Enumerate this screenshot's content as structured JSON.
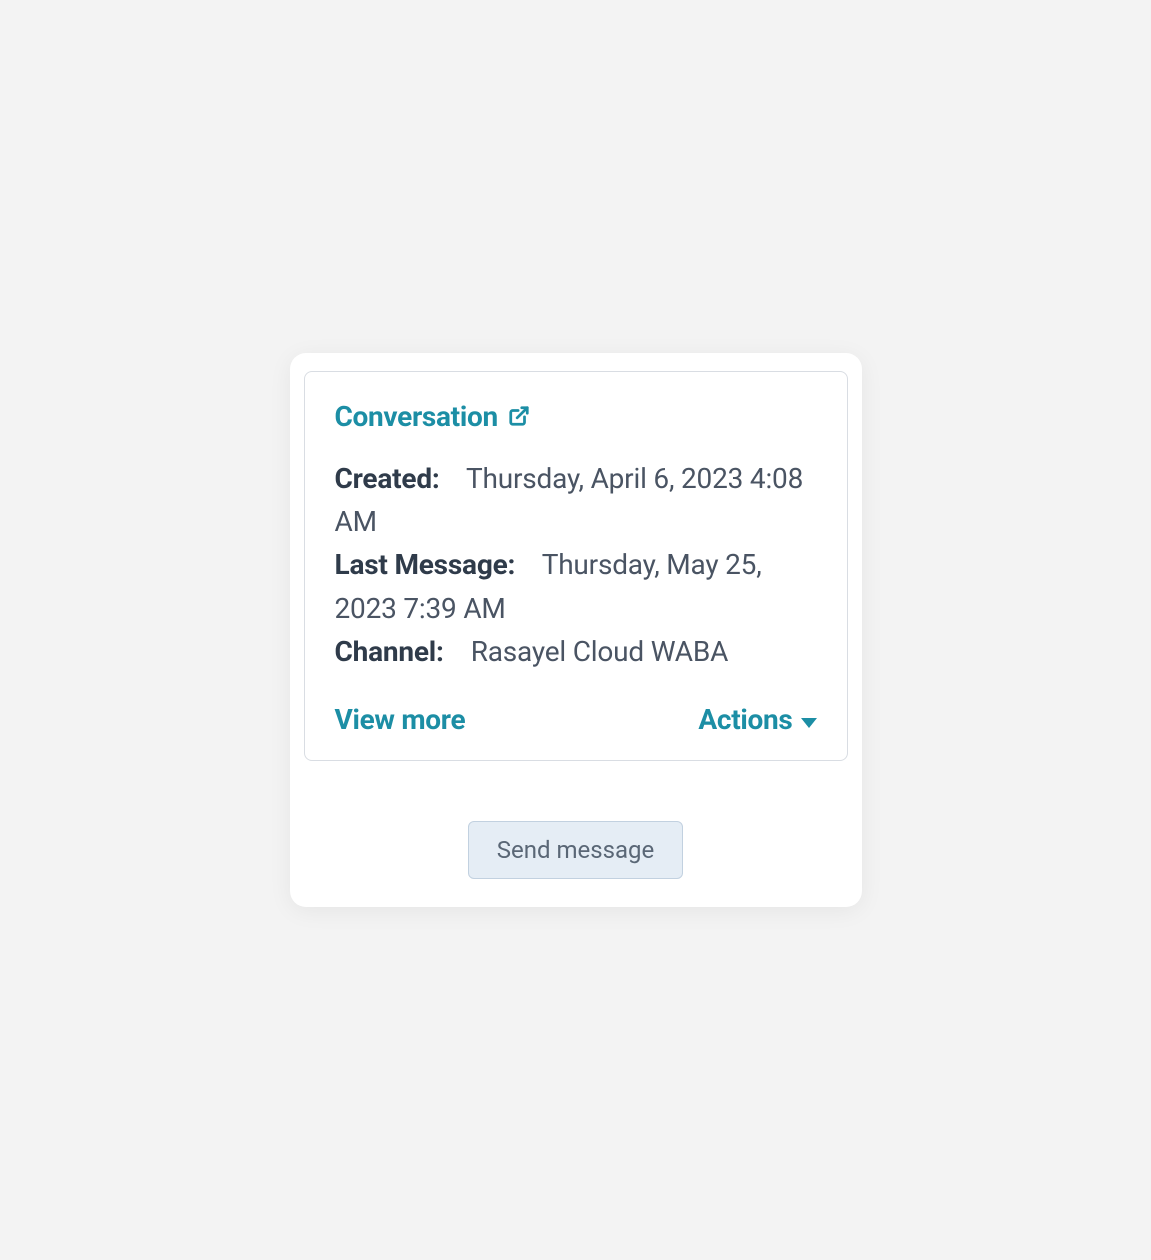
{
  "conversation": {
    "title": "Conversation",
    "details": {
      "created_label": "Created:",
      "created_value": "Thursday, April 6, 2023 4:08 AM",
      "last_message_label": "Last Message:",
      "last_message_value": "Thursday, May 25, 2023 7:39 AM",
      "channel_label": "Channel:",
      "channel_value": "Rasayel Cloud WABA"
    },
    "footer": {
      "view_more_label": "View more",
      "actions_label": "Actions"
    }
  },
  "send_button_label": "Send message",
  "colors": {
    "accent": "#1c8ea5",
    "text_dark": "#2f3b4a",
    "text_medium": "#4a5463",
    "button_bg": "#e5edf5"
  }
}
